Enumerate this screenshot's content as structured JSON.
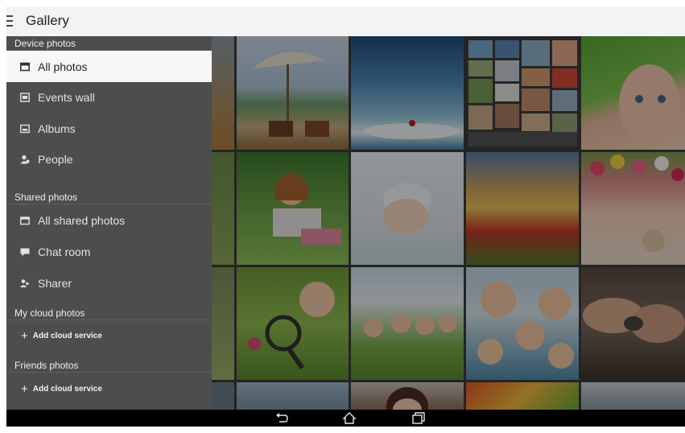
{
  "app": {
    "title": "Gallery"
  },
  "drawer": {
    "sections": [
      {
        "header": "Device photos"
      },
      {
        "header": "Shared photos"
      },
      {
        "header": "My cloud photos"
      },
      {
        "header": "Friends photos"
      }
    ],
    "items": [
      {
        "label": "All photos",
        "icon": "photos-icon",
        "selected": true
      },
      {
        "label": "Events wall",
        "icon": "events-icon"
      },
      {
        "label": "Albums",
        "icon": "album-icon"
      },
      {
        "label": "People",
        "icon": "people-icon"
      },
      {
        "label": "All shared photos",
        "icon": "shared-photos-icon"
      },
      {
        "label": "Chat room",
        "icon": "chat-icon"
      },
      {
        "label": "Sharer",
        "icon": "sharer-icon"
      }
    ],
    "cloud_actions": [
      {
        "label": "Add cloud service"
      },
      {
        "label": "Add cloud service"
      }
    ]
  },
  "grid": {
    "photos": [
      "beach-umbrella-photo",
      "wave-surfer-photo",
      "photo-collage",
      "baby-towel-photo",
      "girl-on-grass-photo",
      "sleeping-baby-photo",
      "tulip-field-photo",
      "flower-crown-girl-photo",
      "magnifier-girl-photo",
      "kids-lying-grass-photo",
      "kids-group-photo",
      "hands-stone-photo"
    ]
  },
  "navbar": {
    "buttons": [
      "back-icon",
      "home-icon",
      "recents-icon"
    ]
  },
  "colors": {
    "drawer_bg": "#4d4d4d",
    "selected_bg": "#f7f7f7",
    "titlebar_bg": "#f3f3f3"
  }
}
